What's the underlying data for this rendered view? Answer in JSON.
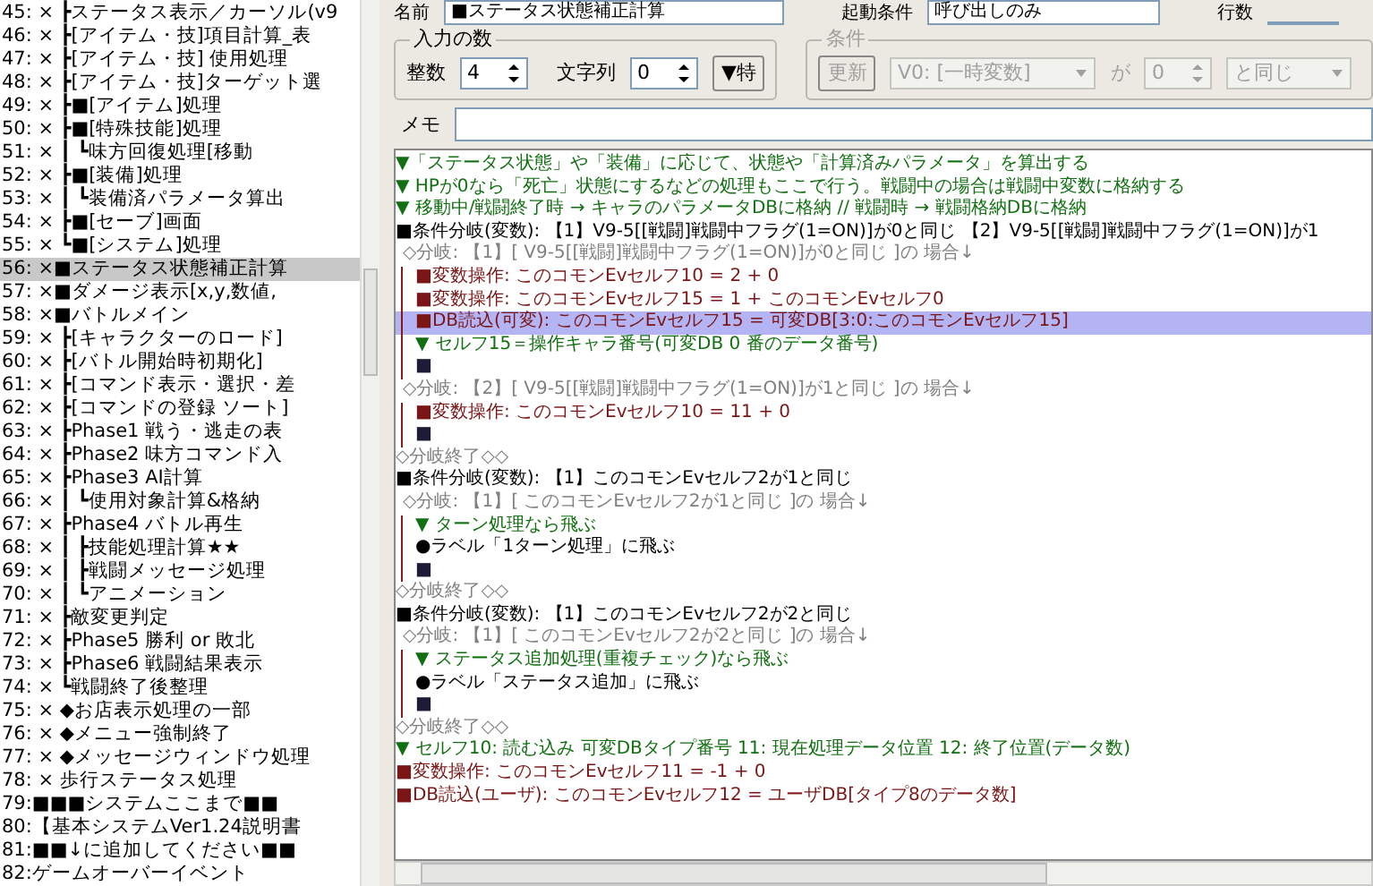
{
  "header": {
    "name_label": "名前",
    "name_value": "■ステータス状態補正計算",
    "trigger_label": "起動条件",
    "trigger_value": "呼び出しのみ",
    "lines_label": "行数"
  },
  "input_count": {
    "title": "入力の数",
    "int_label": "整数",
    "int_value": "4",
    "str_label": "文字列",
    "str_value": "0",
    "special_button": "▼特"
  },
  "condition": {
    "title": "条件",
    "disabled": true,
    "update_button": "更新",
    "variable": "V0: [一時変数]",
    "ga": "が",
    "value": "0",
    "comparison": "と同じ"
  },
  "memo": {
    "label": "メモ"
  },
  "sidebar": {
    "items": [
      {
        "text": "45: × ┣ステータス表示／カーソル(v9",
        "selected": false
      },
      {
        "text": "46: × ┣[アイテム・技]項目計算_表",
        "selected": false
      },
      {
        "text": "47: × ┣[アイテム・技] 使用処理",
        "selected": false
      },
      {
        "text": "48: × ┣[アイテム・技]ターゲット選",
        "selected": false
      },
      {
        "text": "49: × ┣■[アイテム]処理",
        "selected": false
      },
      {
        "text": "50: × ┣■[特殊技能]処理",
        "selected": false
      },
      {
        "text": "51: × ┃ ┗味方回復処理[移動",
        "selected": false
      },
      {
        "text": "52: × ┣■[装備]処理",
        "selected": false
      },
      {
        "text": "53: × ┃ ┗装備済パラメータ算出",
        "selected": false
      },
      {
        "text": "54: × ┣■[セーブ]画面",
        "selected": false
      },
      {
        "text": "55: × ┗■[システム]処理",
        "selected": false
      },
      {
        "text": "56: ×■ステータス状態補正計算",
        "selected": true
      },
      {
        "text": "57: ×■ダメージ表示[x,y,数値,",
        "selected": false
      },
      {
        "text": "58: ×■バトルメイン",
        "selected": false
      },
      {
        "text": "59: × ┣[キャラクターのロード]",
        "selected": false
      },
      {
        "text": "60: × ┣[バトル開始時初期化]",
        "selected": false
      },
      {
        "text": "61: × ┣[コマンド表示・選択・差",
        "selected": false
      },
      {
        "text": "62: × ┣[コマンドの登録 ソート]",
        "selected": false
      },
      {
        "text": "63: × ┣Phase1 戦う・逃走の表",
        "selected": false
      },
      {
        "text": "64: × ┣Phase2 味方コマンド入",
        "selected": false
      },
      {
        "text": "65: × ┣Phase3 AI計算",
        "selected": false
      },
      {
        "text": "66: × ┃ ┗使用対象計算&格納",
        "selected": false
      },
      {
        "text": "67: × ┣Phase4 バトル再生",
        "selected": false
      },
      {
        "text": "68: × ┃ ┣技能処理計算★★",
        "selected": false
      },
      {
        "text": "69: × ┃ ┣戦闘メッセージ処理",
        "selected": false
      },
      {
        "text": "70: × ┃ ┗アニメーション",
        "selected": false
      },
      {
        "text": "71: × ┣敵変更判定",
        "selected": false
      },
      {
        "text": "72: × ┣Phase5 勝利 or 敗北",
        "selected": false
      },
      {
        "text": "73: × ┣Phase6 戦闘結果表示",
        "selected": false
      },
      {
        "text": "74: × ┗戦闘終了後整理",
        "selected": false
      },
      {
        "text": "75: × ◆お店表示処理の一部",
        "selected": false
      },
      {
        "text": "76: × ◆メニュー強制終了",
        "selected": false
      },
      {
        "text": "77: × ◆メッセージウィンドウ処理",
        "selected": false
      },
      {
        "text": "78: × 歩行ステータス処理",
        "selected": false
      },
      {
        "text": "79:■■■システムここまで■■",
        "selected": false
      },
      {
        "text": "80:【基本システムVer1.24説明書",
        "selected": false
      },
      {
        "text": "81:■■↓に追加してください■■",
        "selected": false
      },
      {
        "text": "82:ゲームオーバーイベント",
        "selected": false
      }
    ]
  },
  "events": [
    {
      "kind": "comment",
      "text": "▼「ステータス状態」や「装備」に応じて、状態や「計算済みパラメータ」を算出する",
      "selected": false
    },
    {
      "kind": "comment",
      "text": "▼ HPが0なら「死亡」状態にするなどの処理もここで行う。戦闘中の場合は戦闘中変数に格納する",
      "selected": false
    },
    {
      "kind": "comment",
      "text": "▼ 移動中/戦闘終了時 → キャラのパラメータDBに格納 // 戦闘時 → 戦闘格納DBに格納",
      "selected": false
    },
    {
      "kind": "branch",
      "text": "■条件分岐(変数): 【1】V9-5[[戦闘]戦闘中フラグ(1=ON)]が0と同じ 【2】V9-5[[戦闘]戦闘中フラグ(1=ON)]が1",
      "selected": false
    },
    {
      "kind": "case",
      "text": "◇分岐: 【1】[ V9-5[[戦闘]戦闘中フラグ(1=ON)]が0と同じ ]の 場合↓",
      "selected": false,
      "children": [
        {
          "kind": "operation",
          "text": "■変数操作: このコモンEvセルフ10 = 2 + 0",
          "selected": false
        },
        {
          "kind": "operation",
          "text": "■変数操作: このコモンEvセルフ15 = 1 + このコモンEvセルフ0",
          "selected": false
        },
        {
          "kind": "operation",
          "text": "■DB読込(可変): このコモンEvセルフ15 = 可変DB[3:0:このコモンEvセルフ15]",
          "selected": true
        },
        {
          "kind": "comment",
          "text": "▼ セルフ15＝操作キャラ番号(可変DB 0 番のデータ番号)",
          "selected": false
        },
        {
          "kind": "empty",
          "text": "■",
          "selected": false
        }
      ]
    },
    {
      "kind": "case",
      "text": "◇分岐: 【2】[ V9-5[[戦闘]戦闘中フラグ(1=ON)]が1と同じ ]の 場合↓",
      "selected": false,
      "children": [
        {
          "kind": "operation",
          "text": "■変数操作: このコモンEvセルフ10 = 11 + 0",
          "selected": false
        },
        {
          "kind": "empty",
          "text": "■",
          "selected": false
        }
      ]
    },
    {
      "kind": "end",
      "text": "◇分岐終了◇◇",
      "selected": false
    },
    {
      "kind": "branch",
      "text": "■条件分岐(変数): 【1】このコモンEvセルフ2が1と同じ",
      "selected": false
    },
    {
      "kind": "case",
      "text": "◇分岐: 【1】[ このコモンEvセルフ2が1と同じ ]の 場合↓",
      "selected": false,
      "children": [
        {
          "kind": "comment",
          "text": "▼ ターン処理なら飛ぶ",
          "selected": false
        },
        {
          "kind": "label",
          "text": "●ラベル「1ターン処理」に飛ぶ",
          "selected": false
        },
        {
          "kind": "empty",
          "text": "■",
          "selected": false
        }
      ]
    },
    {
      "kind": "end",
      "text": "◇分岐終了◇◇",
      "selected": false
    },
    {
      "kind": "branch",
      "text": "■条件分岐(変数): 【1】このコモンEvセルフ2が2と同じ",
      "selected": false
    },
    {
      "kind": "case",
      "text": "◇分岐: 【1】[ このコモンEvセルフ2が2と同じ ]の 場合↓",
      "selected": false,
      "children": [
        {
          "kind": "comment",
          "text": "▼ ステータス追加処理(重複チェック)なら飛ぶ",
          "selected": false
        },
        {
          "kind": "label",
          "text": "●ラベル「ステータス追加」に飛ぶ",
          "selected": false
        },
        {
          "kind": "empty",
          "text": "■",
          "selected": false
        }
      ]
    },
    {
      "kind": "end",
      "text": "◇分岐終了◇◇",
      "selected": false
    },
    {
      "kind": "comment",
      "text": "▼ セルフ10: 読む込み 可変DBタイプ番号 11: 現在処理データ位置 12: 終了位置(データ数)",
      "selected": false
    },
    {
      "kind": "operation",
      "text": "■変数操作: このコモンEvセルフ11 = -1 + 0",
      "selected": false
    },
    {
      "kind": "operation",
      "text": "■DB読込(ユーザ): このコモンEvセルフ12 = ユーザDB[タイプ8のデータ数]",
      "selected": false
    }
  ]
}
